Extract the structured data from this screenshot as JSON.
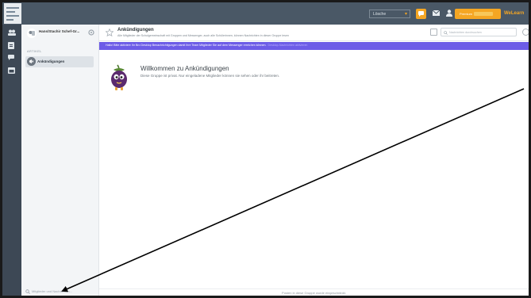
{
  "topbar": {
    "select_label": "Lösche",
    "upgrade_label": "Premium",
    "brand": "WeLearn"
  },
  "sidebar": {
    "group_name": "Hans/Stachir Schef-Gr...",
    "section_label": "ARTIKEL",
    "channel_label": "Ankündigungen",
    "search_placeholder": "Mitglieder und Nachrichten..."
  },
  "channel": {
    "title": "Ankündigungen",
    "description": "Alle Mitglieder der Schulgemeinschaft mit Gruppen und Messenger, auch alle Schülerinnen, können Nachrichten in dieser Gruppe lesen",
    "search_placeholder": "Nachrichten durchsuchen"
  },
  "banner": {
    "text": "Hallo! Bitte aktiviere Ihr Bro Desktop Benachrichtigungen damit Ihre Team Mitglieder Sie auf dem Messenger erreichen können.",
    "link": "Desktop-Nachrichten aktivieren"
  },
  "welcome": {
    "title": "Willkommen zu Ankündigungen",
    "text": "Diese Gruppe ist privat. Nur eingeladene Mitglieder können sie sehen oder ihr beitreten."
  },
  "footer": {
    "text": "Posten in diese Gruppe wurde eingeschränkt."
  },
  "colors": {
    "topbar": "#4a5866",
    "accent": "#f5a623",
    "banner": "#6c5ce7",
    "sidebar": "#f3f5f7"
  }
}
